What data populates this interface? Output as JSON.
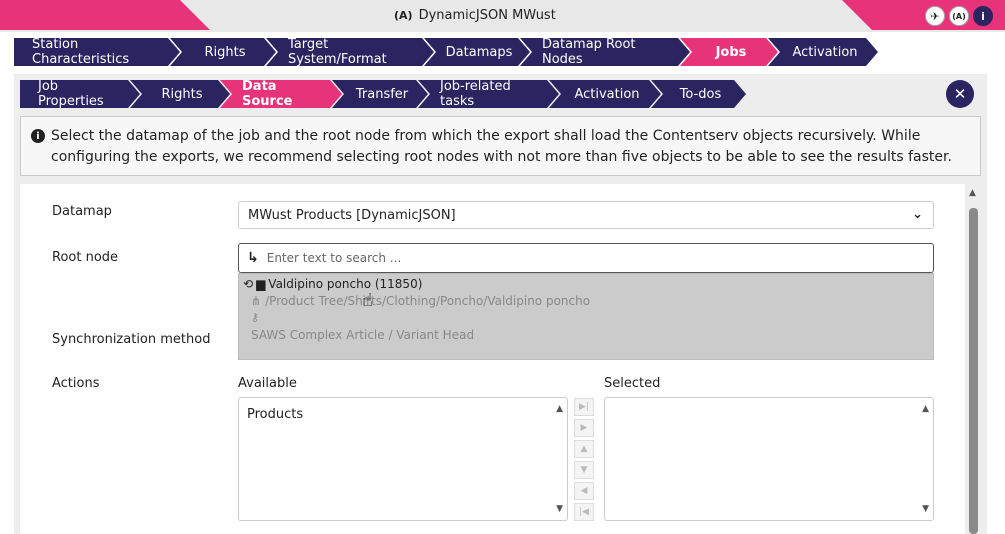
{
  "window": {
    "title": "DynamicJSON MWust",
    "title_icon": "antenna-icon",
    "buttons": [
      {
        "icon": "airplane-icon",
        "glyph": "✈"
      },
      {
        "icon": "antenna-icon",
        "glyph": "(A)"
      },
      {
        "icon": "info-icon",
        "glyph": "i"
      }
    ]
  },
  "main_tabs": [
    "Station Characteristics",
    "Rights",
    "Target System/Format",
    "Datamaps",
    "Datamap Root Nodes",
    "Jobs",
    "Activation"
  ],
  "main_active": "Jobs",
  "sub_tabs": [
    "Job Properties",
    "Rights",
    "Data Source",
    "Transfer",
    "Job-related tasks",
    "Activation",
    "To-dos"
  ],
  "sub_active": "Data Source",
  "close_glyph": "✕",
  "info": {
    "icon_glyph": "i",
    "text": "Select the datamap of the job and the root node from which the export shall load the Contentserv objects recursively. While configuring the exports, we recommend selecting root nodes with not more than five objects to be able to see the results faster."
  },
  "form": {
    "datamap_label": "Datamap",
    "datamap_value": "MWust Products [DynamicJSON]",
    "rootnode_label": "Root node",
    "search_placeholder": "Enter text to search ...",
    "sync_label": "Synchronization method",
    "actions_label": "Actions",
    "available_label": "Available",
    "selected_label": "Selected",
    "available_items": [
      "Products"
    ],
    "selected_items": []
  },
  "dropdown": {
    "name": "Valdipino poncho (11850)",
    "path": "/Product Tree/Shirts/Clothing/Poncho/Valdipino poncho",
    "type": "SAWS Complex Article / Variant Head"
  },
  "colors": {
    "accent": "#e6337a",
    "navy": "#2a2460"
  }
}
